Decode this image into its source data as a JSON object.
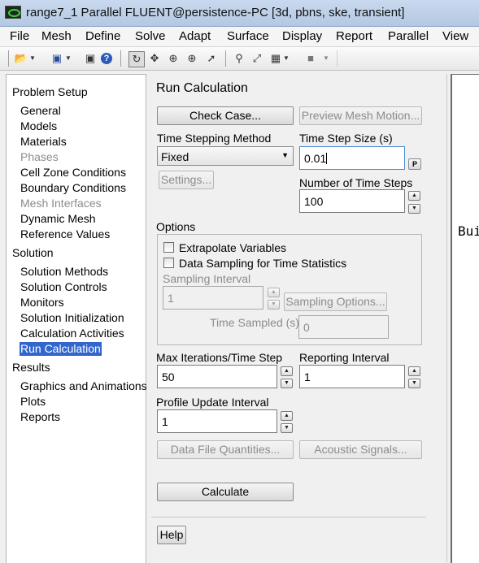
{
  "window": {
    "title": "range7_1 Parallel FLUENT@persistence-PC  [3d, pbns, ske, transient]"
  },
  "menu": [
    "File",
    "Mesh",
    "Define",
    "Solve",
    "Adapt",
    "Surface",
    "Display",
    "Report",
    "Parallel",
    "View"
  ],
  "tree": {
    "problem_setup": "Problem Setup",
    "general": "General",
    "models": "Models",
    "materials": "Materials",
    "phases": "Phases",
    "cell_zone_conditions": "Cell Zone Conditions",
    "boundary_conditions": "Boundary Conditions",
    "mesh_interfaces": "Mesh Interfaces",
    "dynamic_mesh": "Dynamic Mesh",
    "reference_values": "Reference Values",
    "solution": "Solution",
    "solution_methods": "Solution Methods",
    "solution_controls": "Solution Controls",
    "monitors": "Monitors",
    "solution_initialization": "Solution Initialization",
    "calculation_activities": "Calculation Activities",
    "run_calculation": "Run Calculation",
    "results": "Results",
    "graphics_and_animations": "Graphics and Animations",
    "plots": "Plots",
    "reports": "Reports"
  },
  "panel": {
    "title": "Run Calculation",
    "check_case": "Check Case...",
    "preview_mesh_motion": "Preview Mesh Motion...",
    "time_stepping_method_label": "Time Stepping Method",
    "time_stepping_method_value": "Fixed",
    "time_step_size_label": "Time Step Size (s)",
    "time_step_size_value": "0.01",
    "parameter_button": "P",
    "settings": "Settings...",
    "number_of_time_steps_label": "Number of Time Steps",
    "number_of_time_steps_value": "100",
    "options_label": "Options",
    "extrapolate_variables": "Extrapolate Variables",
    "data_sampling": "Data Sampling for Time Statistics",
    "sampling_interval_label": "Sampling Interval",
    "sampling_interval_value": "1",
    "sampling_options": "Sampling Options...",
    "time_sampled_label": "Time Sampled (s)",
    "time_sampled_value": "0",
    "max_iterations_label": "Max Iterations/Time Step",
    "max_iterations_value": "50",
    "reporting_interval_label": "Reporting Interval",
    "reporting_interval_value": "1",
    "profile_update_interval_label": "Profile Update Interval",
    "profile_update_interval_value": "1",
    "data_file_quantities": "Data File Quantities...",
    "acoustic_signals": "Acoustic Signals...",
    "calculate": "Calculate",
    "help": "Help"
  },
  "graphics": {
    "text": "Bui"
  },
  "toolbar_icons": [
    "open-icon",
    "save-icon",
    "camera-icon",
    "help-icon",
    "rotate-icon",
    "pan-icon",
    "zoom-in-icon",
    "zoom-box-icon",
    "probe-icon",
    "zoom-fit-icon",
    "axes-icon",
    "layout-icon",
    "color-icon"
  ]
}
